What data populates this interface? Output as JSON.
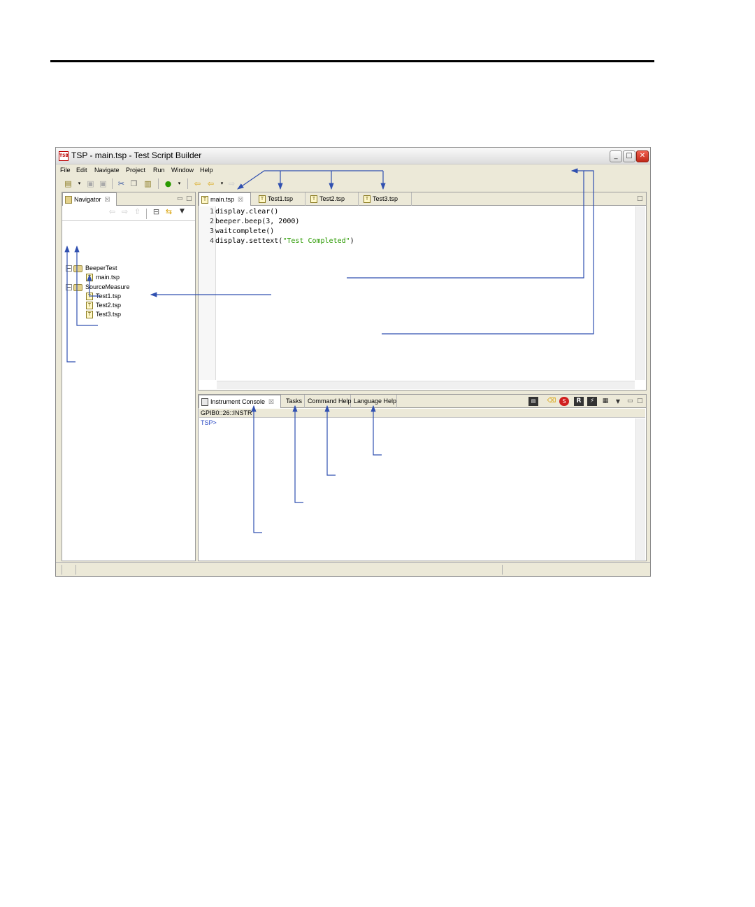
{
  "window": {
    "title": "TSP - main.tsp - Test Script Builder",
    "app_icon_label": "TSB",
    "minimize_glyph": "_",
    "maximize_glyph": "□",
    "close_glyph": "✕"
  },
  "menu": [
    "File",
    "Edit",
    "Navigate",
    "Project",
    "Run",
    "Window",
    "Help"
  ],
  "navigator": {
    "tab_label": "Navigator",
    "projects": [
      {
        "name": "BeeperTest",
        "files": [
          "main.tsp"
        ]
      },
      {
        "name": "SourceMeasure",
        "files": [
          "Test1.tsp",
          "Test2.tsp",
          "Test3.tsp"
        ]
      }
    ]
  },
  "editor": {
    "tabs": [
      "main.tsp",
      "Test1.tsp",
      "Test2.tsp",
      "Test3.tsp"
    ],
    "active_tab": "main.tsp",
    "lines": [
      {
        "n": "1",
        "code": "display.clear()"
      },
      {
        "n": "2",
        "code": "beeper.beep(3, 2000)"
      },
      {
        "n": "3",
        "code": "waitcomplete()"
      },
      {
        "n": "4",
        "code": "display.settext(",
        "string": "\"Test Completed\"",
        "tail": ")"
      }
    ]
  },
  "console": {
    "tabs": [
      "Instrument Console",
      "Tasks",
      "Command Help",
      "Language Help"
    ],
    "connection": "GPIB0::26::INSTR",
    "prompt": "TSP>"
  },
  "icons": {
    "close_tab": "☒",
    "tsp_file": "T"
  },
  "colors": {
    "string_literal": "#2a9a00",
    "prompt": "#2040c0",
    "callout_line": "#3050b0",
    "close_button": "#c02818"
  }
}
